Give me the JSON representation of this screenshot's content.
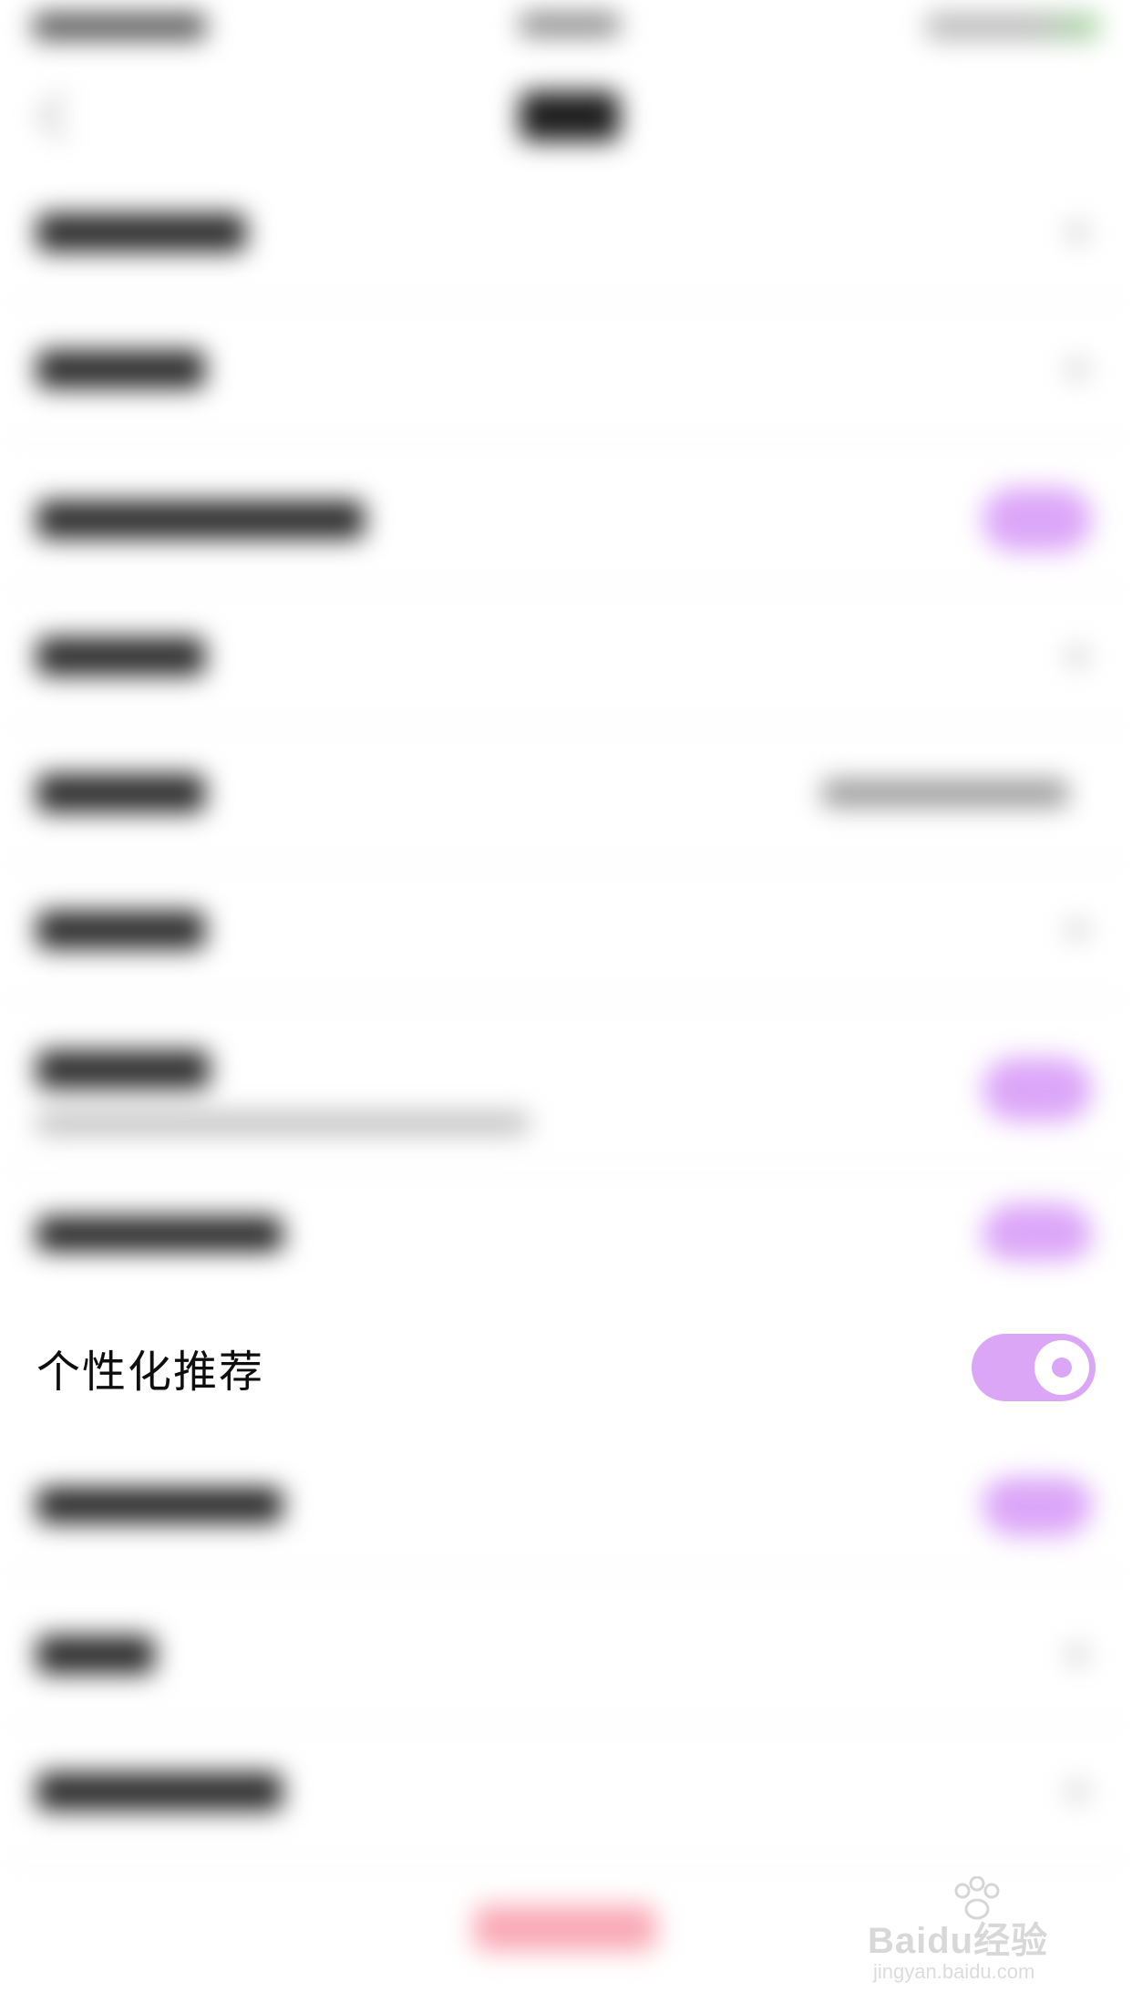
{
  "settings": {
    "personalized_recommendation": {
      "label": "个性化推荐",
      "enabled": true,
      "toggle_color": "#dca6f7"
    }
  },
  "watermark": {
    "brand": "Baidu经验",
    "url": "jingyan.baidu.com"
  },
  "colors": {
    "accent": "#dca6f7",
    "logout": "#f9a9b5"
  }
}
